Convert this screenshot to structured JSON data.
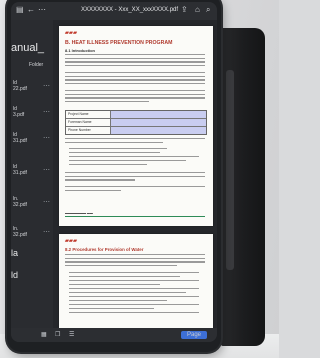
{
  "app": {
    "filename": "XXXXXXXX - Xxx_XX_xxxXXXX.pdf"
  },
  "sidebar": {
    "title": "anual_",
    "folder_label": "Folder",
    "items": [
      {
        "label": "ld"
      },
      {
        "label": "22.pdf"
      },
      {
        "label": "ld"
      },
      {
        "label": "3.pdf"
      },
      {
        "label": "ld"
      },
      {
        "label": "31.pdf"
      },
      {
        "label": "ld"
      },
      {
        "label": "31.pdf"
      },
      {
        "label": "ln."
      },
      {
        "label": "32.pdf"
      },
      {
        "label": "ln."
      },
      {
        "label": "32.pdf"
      },
      {
        "label": "la"
      },
      {
        "label": "ld"
      }
    ]
  },
  "document": {
    "page1": {
      "heading": "B. HEAT ILLNESS PREVENTION PROGRAM",
      "section": "8.1 Introduction",
      "form_rows": [
        {
          "label": "Project Name"
        },
        {
          "label": "Foreman Name"
        },
        {
          "label": "Phone Number"
        }
      ]
    },
    "page2": {
      "section": "8.2 Procedures for Provision of Water"
    }
  },
  "toolbar": {
    "page_button": "Page"
  }
}
